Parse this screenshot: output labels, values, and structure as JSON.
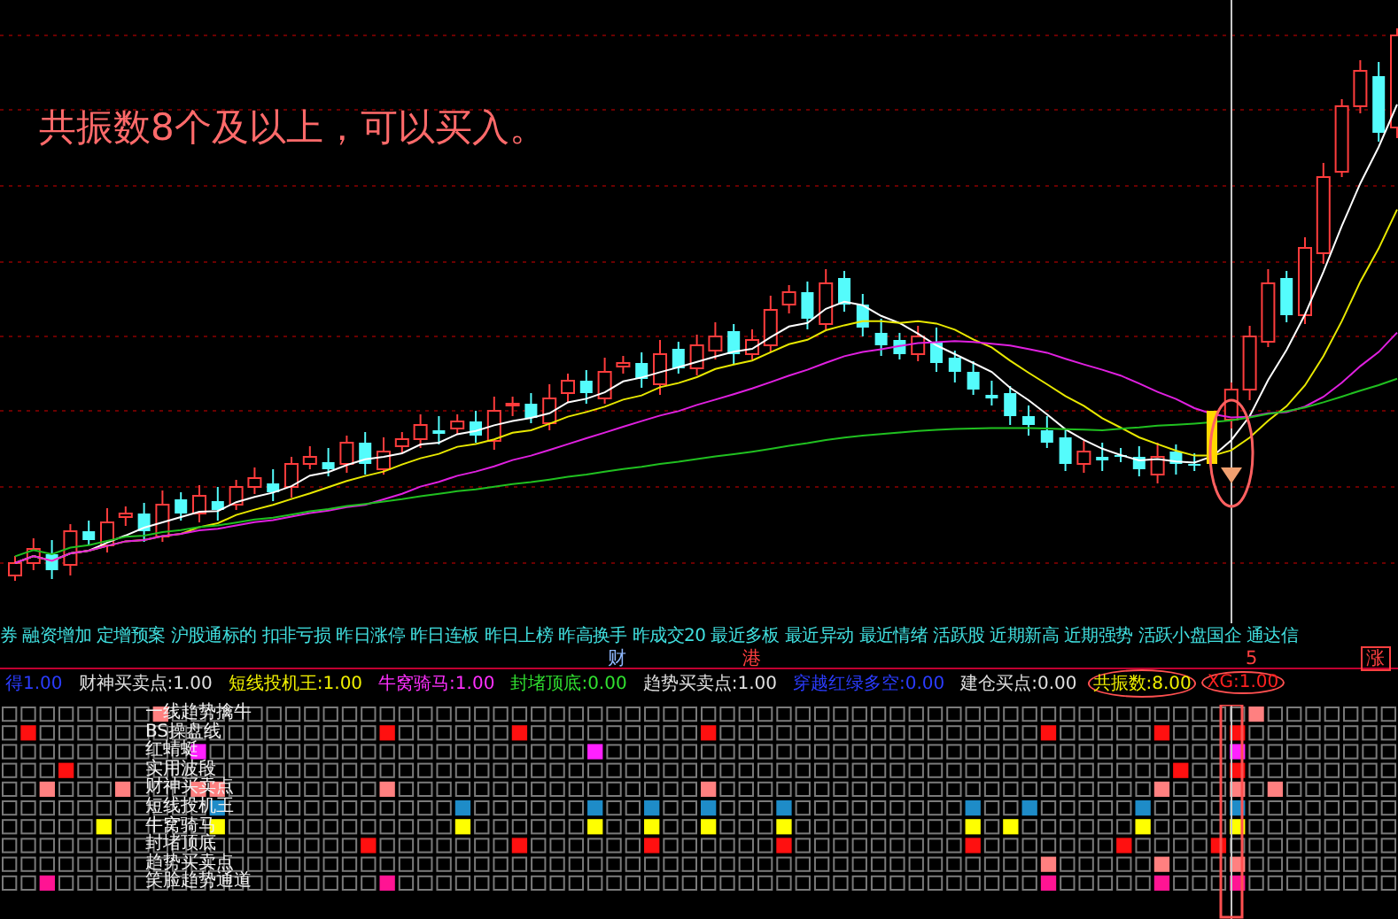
{
  "annotation": {
    "text": "共振数8个及以上，可以买入。"
  },
  "tag_bar": {
    "tags": [
      "券",
      "融资增加",
      "定增预案",
      "沪股通标的",
      "扣非亏损",
      "昨日涨停",
      "昨日连板",
      "昨日上榜",
      "昨高换手",
      "昨成交20",
      "最近多板",
      "最近异动",
      "最近情绪",
      "活跃股",
      "近期新高",
      "近期强势",
      "活跃小盘国企",
      "通达信"
    ]
  },
  "markers": [
    {
      "text": "财",
      "color": "#8fb8ff"
    },
    {
      "text": "港",
      "color": "#ff4040"
    },
    {
      "text": "5",
      "color": "#ff4040"
    },
    {
      "text": "涨",
      "color": "#ff4040"
    }
  ],
  "indicators": [
    {
      "label": "得",
      "value": "1.00",
      "color": "#2b3cff",
      "circled": false
    },
    {
      "label": "财神买卖点:",
      "value": "1.00",
      "color": "#e0e0e0",
      "circled": false
    },
    {
      "label": "短线投机王:",
      "value": "1.00",
      "color": "#f0f000",
      "circled": false
    },
    {
      "label": "牛窝骑马:",
      "value": "1.00",
      "color": "#ff30ff",
      "circled": false
    },
    {
      "label": "封堵顶底:",
      "value": "0.00",
      "color": "#30e030",
      "circled": false
    },
    {
      "label": "趋势买卖点:",
      "value": "1.00",
      "color": "#e0e0e0",
      "circled": false
    },
    {
      "label": "穿越红绿多空:",
      "value": "0.00",
      "color": "#2b3cff",
      "circled": false
    },
    {
      "label": "建仓买点:",
      "value": "0.00",
      "color": "#e0e0e0",
      "circled": false
    },
    {
      "label": "共振数:",
      "value": "8.00",
      "color": "#f0f000",
      "circled": true
    },
    {
      "label": "XG:",
      "value": "1.00",
      "color": "#ff2020",
      "circled": true
    }
  ],
  "signal_grid": {
    "rows": [
      {
        "label": "一线趋势擒牛",
        "color": "#ff8080"
      },
      {
        "label": "BS操盘线",
        "color": "#ff1010"
      },
      {
        "label": "红蜻蜓",
        "color": "#ff20ff"
      },
      {
        "label": "实用波段",
        "color": "#ff1010"
      },
      {
        "label": "财神买卖点",
        "color": "#ff8080"
      },
      {
        "label": "短线投机王",
        "color": "#1e8cc8"
      },
      {
        "label": "牛窝骑马",
        "color": "#ffff00"
      },
      {
        "label": "封堵顶底",
        "color": "#ff1010"
      },
      {
        "label": "趋势买卖点",
        "color": "#ff8080"
      },
      {
        "label": "笑脸趋势通道",
        "color": "#ff1493"
      }
    ]
  }
}
